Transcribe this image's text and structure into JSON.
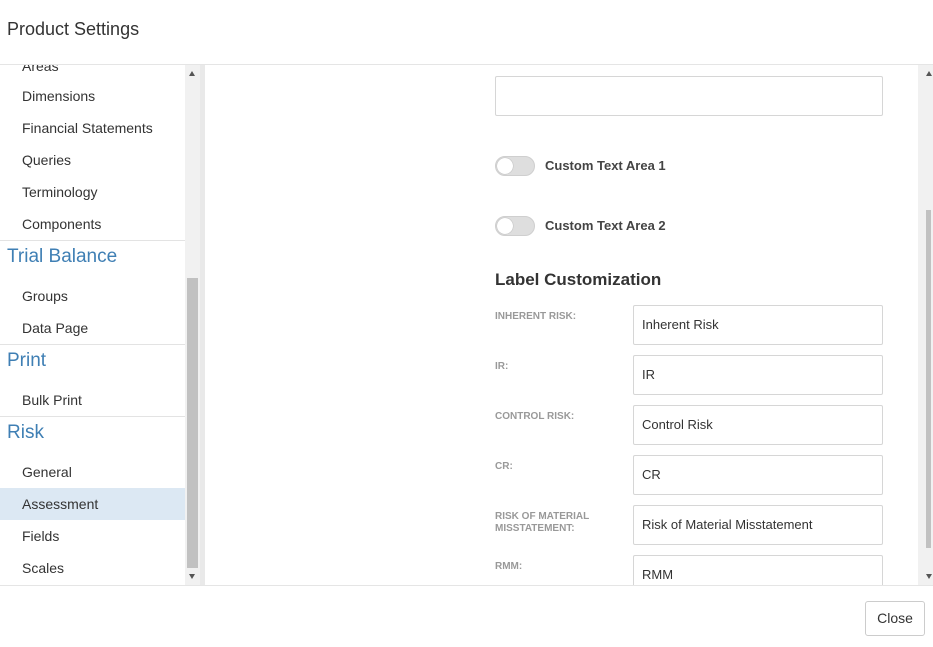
{
  "window": {
    "title": "Product Settings"
  },
  "sidebar": {
    "items": [
      {
        "label": "Areas"
      },
      {
        "label": "Dimensions"
      },
      {
        "label": "Financial Statements"
      },
      {
        "label": "Queries"
      },
      {
        "label": "Terminology"
      },
      {
        "label": "Components"
      }
    ],
    "sections": [
      {
        "title": "Trial Balance",
        "items": [
          {
            "label": "Groups"
          },
          {
            "label": "Data Page"
          }
        ]
      },
      {
        "title": "Print",
        "items": [
          {
            "label": "Bulk Print"
          }
        ]
      },
      {
        "title": "Risk",
        "items": [
          {
            "label": "General"
          },
          {
            "label": "Assessment",
            "active": true
          },
          {
            "label": "Fields"
          },
          {
            "label": "Scales"
          }
        ]
      }
    ]
  },
  "main": {
    "toggles": [
      {
        "label": "Custom Text Area 1",
        "on": false
      },
      {
        "label": "Custom Text Area 2",
        "on": false
      }
    ],
    "label_customization": {
      "heading": "Label Customization",
      "fields": [
        {
          "label": "INHERENT RISK:",
          "value": "Inherent Risk"
        },
        {
          "label": "IR:",
          "value": "IR"
        },
        {
          "label": "CONTROL RISK:",
          "value": "Control Risk"
        },
        {
          "label": "CR:",
          "value": "CR"
        },
        {
          "label": "RISK OF MATERIAL MISSTATEMENT:",
          "value": "Risk of Material Misstatement"
        },
        {
          "label": "RMM:",
          "value": "RMM"
        }
      ]
    }
  },
  "footer": {
    "close_label": "Close"
  },
  "colors": {
    "accent": "#3f7fb4",
    "active_bg": "#dce8f3"
  }
}
